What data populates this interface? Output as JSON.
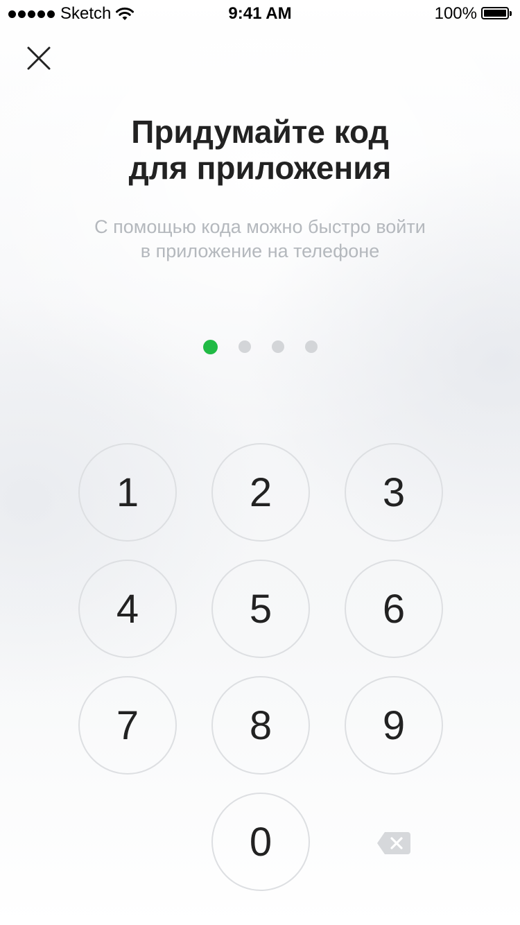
{
  "status_bar": {
    "carrier": "Sketch",
    "time": "9:41 AM",
    "battery": "100%"
  },
  "close_icon": "close-icon",
  "title": {
    "line1": "Придумайте код",
    "line2": "для приложения"
  },
  "subtitle": {
    "line1": "С помощью кода можно быстро войти",
    "line2": "в приложение на телефоне"
  },
  "code": {
    "length": 4,
    "entered": 1
  },
  "keypad": {
    "keys": [
      "1",
      "2",
      "3",
      "4",
      "5",
      "6",
      "7",
      "8",
      "9",
      "0"
    ],
    "backspace_icon": "backspace-icon"
  },
  "colors": {
    "accent": "#21ba45",
    "dot_empty": "#d3d5d8",
    "key_border": "#dddfe2",
    "subtitle": "#b4b8bd",
    "text": "#222222"
  }
}
